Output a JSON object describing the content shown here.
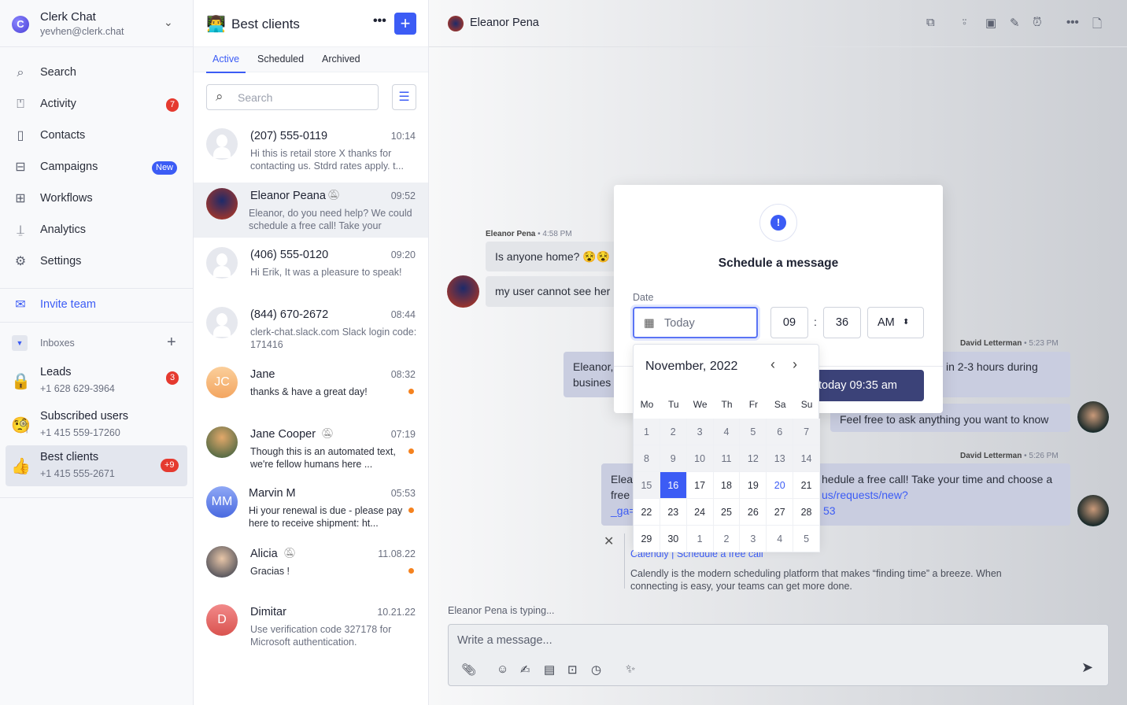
{
  "org": {
    "name": "Clerk Chat",
    "email": "yevhen@clerk.chat"
  },
  "nav": [
    {
      "label": "Search",
      "icon": "search-icon"
    },
    {
      "label": "Activity",
      "icon": "mailbox-icon",
      "badge": "7"
    },
    {
      "label": "Contacts",
      "icon": "contact-book-icon"
    },
    {
      "label": "Campaigns",
      "icon": "inbox-tray-icon",
      "badge": "New"
    },
    {
      "label": "Workflows",
      "icon": "workflow-icon"
    },
    {
      "label": "Analytics",
      "icon": "presentation-icon"
    },
    {
      "label": "Settings",
      "icon": "gear-icon"
    }
  ],
  "invite": "Invite team",
  "inboxes": {
    "title": "Inboxes",
    "items": [
      {
        "name": "Leads",
        "phone": "+1 628 629-3964",
        "emoji": "🔒",
        "badge": "3"
      },
      {
        "name": "Subscribed users",
        "phone": "+1 415 559-17260",
        "emoji": "🧐"
      },
      {
        "name": "Best clients",
        "phone": "+1 415 555-2671",
        "emoji": "👍",
        "badge": "+9"
      }
    ]
  },
  "list": {
    "title": "Best clients",
    "emoji": "👨‍💻",
    "tabs": [
      "Active",
      "Scheduled",
      "Archived"
    ],
    "search_placeholder": "Search",
    "conversations": [
      {
        "name": "(207) 555-0119",
        "time": "10:14",
        "preview": "Hi this is retail store X thanks for contacting us. Stdrd rates apply. t..."
      },
      {
        "name": "Eleanor Peana",
        "time": "09:52",
        "preview": "Eleanor, do you need help? We could schedule a free call! Take your",
        "muted": true
      },
      {
        "name": "(406) 555-0120",
        "time": "09:20",
        "preview": "Hi Erik, It was a pleasure to speak!"
      },
      {
        "name": "(844) 670-2672",
        "time": "08:44",
        "preview": "clerk-chat.slack.com Slack login code: 171416"
      },
      {
        "name": "Jane",
        "initials": "JC",
        "time": "08:32",
        "preview": "thanks & have a great day!",
        "unread": true
      },
      {
        "name": "Jane Cooper",
        "time": "07:19",
        "preview": "Though this is an automated text, we're fellow humans here ...",
        "muted": true,
        "unread": true
      },
      {
        "name": "Marvin M",
        "initials": "MM",
        "time": "05:53",
        "preview": "Hi your renewal is due - please pay here to receive shipment: ht...",
        "unread": true
      },
      {
        "name": "Alicia",
        "time": "11.08.22",
        "preview": "Gracias !",
        "muted": true,
        "unread": true
      },
      {
        "name": "Dimitar",
        "initials": "D",
        "time": "10.21.22",
        "preview": "Use verification code 327178 for Microsoft authentication."
      }
    ]
  },
  "chat": {
    "contact": "Eleanor Pena",
    "messages": [
      {
        "author": "Eleanor Pena",
        "time": "4:58 PM",
        "texts": [
          "Is anyone home? 😵😵",
          "my user cannot see her"
        ]
      },
      {
        "author": "David Letterman",
        "time": "5:23 PM",
        "texts": [
          "Eleanor,",
          "busines",
          "in 2-3 hours during",
          "Feel free to ask anything you want to know"
        ]
      },
      {
        "author": "David Letterman",
        "time": "5:26 PM",
        "texts": [
          "Elea",
          "free",
          "_ga=",
          "hedule a free call! Take your time and choose a",
          "us/requests/new?",
          "53"
        ]
      }
    ],
    "preview": {
      "title": "Calendly | Schedule a free call",
      "description": "Calendly is the modern scheduling platform that makes “finding time” a breeze. When connecting is easy, your teams can get more done."
    },
    "typing": "Eleanor Pena is typing...",
    "composer_placeholder": "Write a message..."
  },
  "modal": {
    "title": "Schedule a message",
    "date_label": "Date",
    "date_value": "Today",
    "hour": "09",
    "minute": "36",
    "ampm": "AM",
    "submit": "today 09:35 am"
  },
  "calendar": {
    "month": "November, 2022",
    "weekdays": [
      "Mo",
      "Tu",
      "We",
      "Th",
      "Fr",
      "Sa",
      "Su"
    ],
    "days": [
      "1",
      "2",
      "3",
      "4",
      "5",
      "6",
      "7",
      "8",
      "9",
      "10",
      "11",
      "12",
      "13",
      "14",
      "15",
      "16",
      "17",
      "18",
      "19",
      "20",
      "21",
      "22",
      "23",
      "24",
      "25",
      "26",
      "27",
      "28",
      "29",
      "30",
      "1",
      "2",
      "3",
      "4",
      "5"
    ],
    "selected": "16",
    "highlighted": "20"
  },
  "colors": {
    "accent": "#3c5cf5",
    "badge": "#e53a2f",
    "unread": "#f5821f",
    "submit": "#3b4278"
  }
}
